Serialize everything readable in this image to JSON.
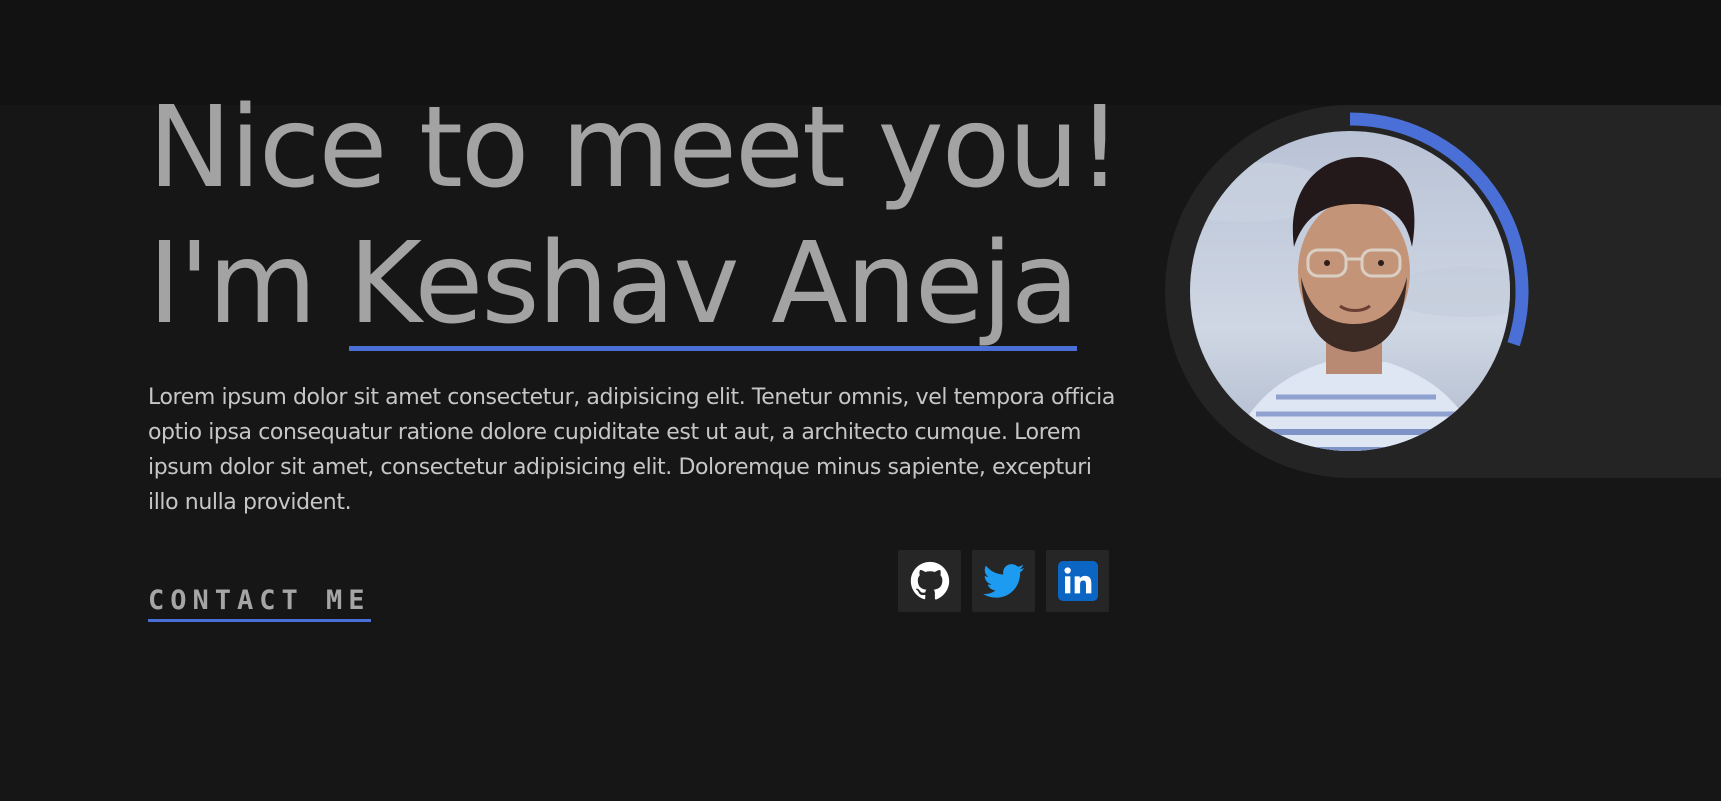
{
  "hero": {
    "greeting": "Nice to meet you!",
    "intro_prefix": "I'm ",
    "name": "Keshav Aneja",
    "bio": "Lorem ipsum dolor sit amet consectetur, adipisicing elit. Tenetur omnis, vel tempora officia optio ipsa consequatur ratione dolore cupiditate est ut aut, a architecto cumque. Lorem ipsum dolor sit amet, consectetur adipisicing elit. Doloremque minus sapiente, excepturi illo nulla provident.",
    "contact_label": "CONTACT ME"
  },
  "socials": [
    {
      "icon": "github-icon"
    },
    {
      "icon": "twitter-icon"
    },
    {
      "icon": "linkedin-icon"
    }
  ],
  "portrait": {
    "progress_ring_fraction": 0.3
  },
  "colors": {
    "background": "#161616",
    "panel": "#242424",
    "accent": "#4a6fd6",
    "heading_text": "#a3a3a3",
    "twitter": "#1d9bf0",
    "linkedin": "#0a66c2"
  }
}
